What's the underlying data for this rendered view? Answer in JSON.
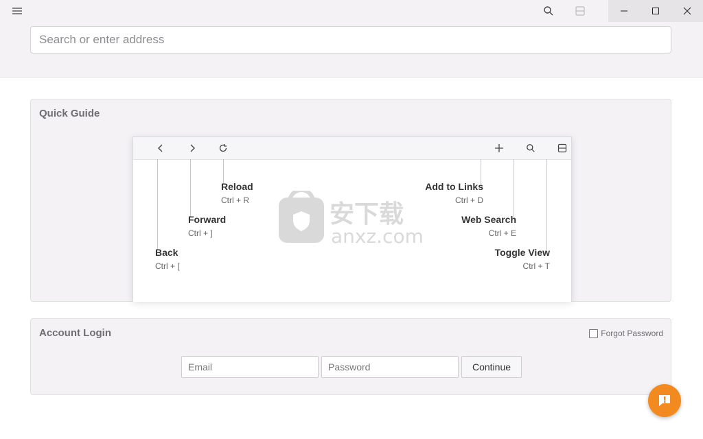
{
  "window": {
    "menu_icon": "hamburger-icon",
    "search_icon": "search-icon",
    "toggle_view_icon": "toggle-view-icon",
    "minimize_icon": "minimize-icon",
    "maximize_icon": "maximize-icon",
    "close_icon": "close-icon"
  },
  "address_bar": {
    "placeholder": "Search or enter address"
  },
  "quick_guide": {
    "title": "Quick Guide",
    "toolbar_icons": [
      "back-icon",
      "forward-icon",
      "reload-icon",
      "add-icon",
      "search-icon",
      "toggle-view-icon"
    ],
    "shortcuts": {
      "reload": {
        "label": "Reload",
        "keys": "Ctrl + R"
      },
      "forward": {
        "label": "Forward",
        "keys": "Ctrl + ]"
      },
      "back": {
        "label": "Back",
        "keys": "Ctrl + ["
      },
      "add_to_links": {
        "label": "Add to Links",
        "keys": "Ctrl + D"
      },
      "web_search": {
        "label": "Web Search",
        "keys": "Ctrl + E"
      },
      "toggle_view": {
        "label": "Toggle View",
        "keys": "Ctrl + T"
      }
    }
  },
  "account_login": {
    "title": "Account Login",
    "forgot_password": "Forgot Password",
    "email_placeholder": "Email",
    "password_placeholder": "Password",
    "continue_label": "Continue"
  },
  "watermark": {
    "text_cn": "安下载",
    "text_en": "anxz.com"
  },
  "feedback": {
    "icon": "exclamation-icon",
    "color": "#f28a1f"
  }
}
